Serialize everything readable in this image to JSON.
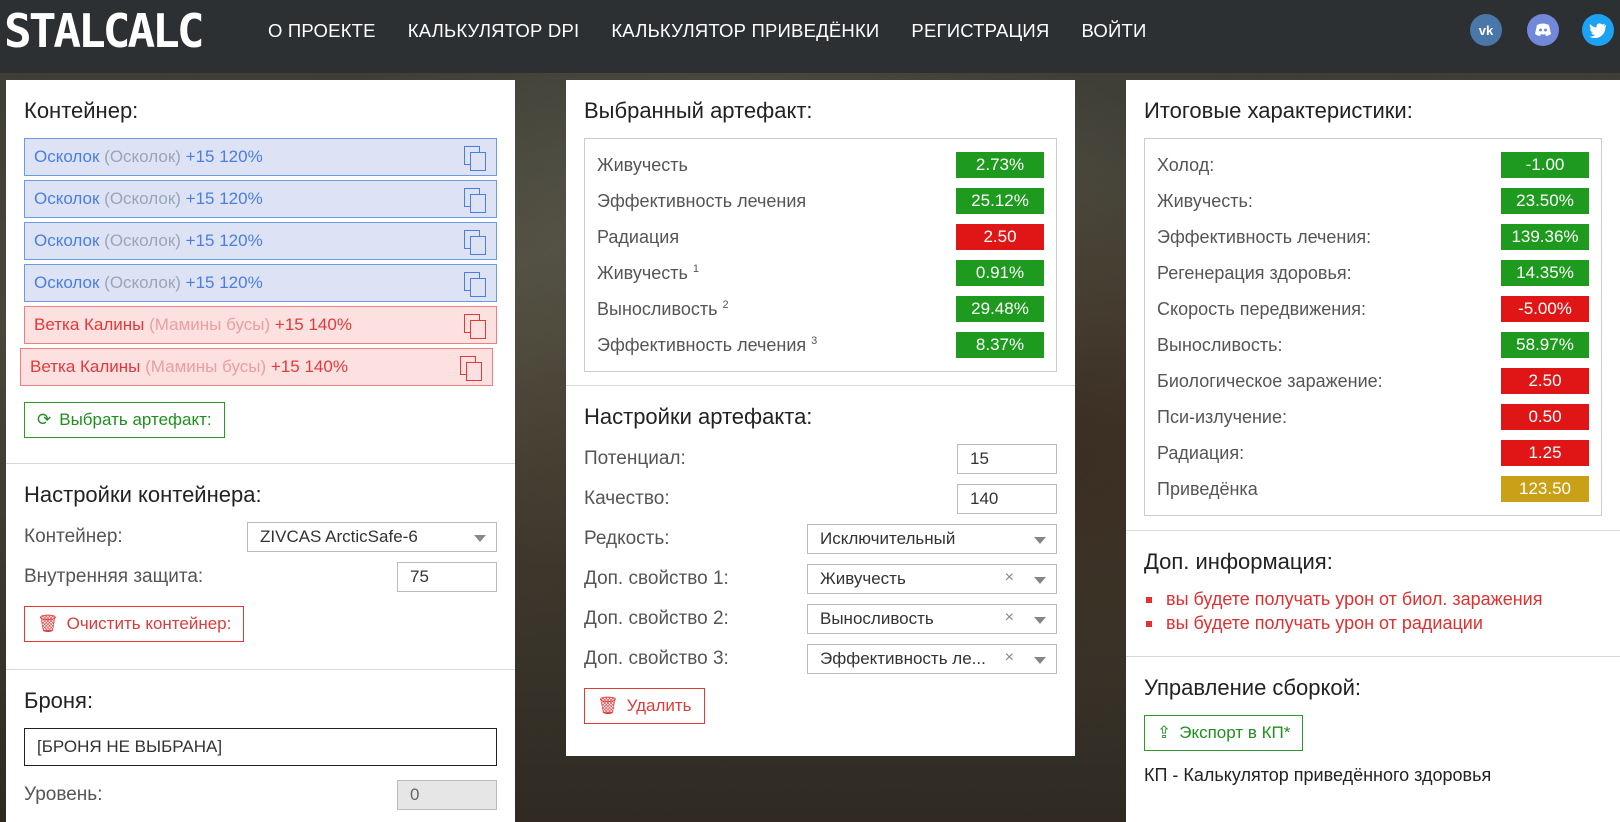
{
  "logo": "STALCALC",
  "nav": [
    "О ПРОЕКТЕ",
    "КАЛЬКУЛЯТОР DPI",
    "КАЛЬКУЛЯТОР ПРИВЕДЁНКИ",
    "РЕГИСТРАЦИЯ",
    "ВОЙТИ"
  ],
  "social": {
    "vk": "vk-icon",
    "discord": "discord-icon",
    "twitter": "twitter-icon"
  },
  "container": {
    "title": "Контейнер:",
    "slots": [
      {
        "name": "Осколок",
        "sub": "(Осколок)",
        "suffix": "+15 120%",
        "color": "blue"
      },
      {
        "name": "Осколок",
        "sub": "(Осколок)",
        "suffix": "+15 120%",
        "color": "blue"
      },
      {
        "name": "Осколок",
        "sub": "(Осколок)",
        "suffix": "+15 120%",
        "color": "blue"
      },
      {
        "name": "Осколок",
        "sub": "(Осколок)",
        "suffix": "+15 120%",
        "color": "blue"
      },
      {
        "name": "Ветка Калины",
        "sub": "(Мамины бусы)",
        "suffix": "+15 140%",
        "color": "red"
      },
      {
        "name": "Ветка Калины",
        "sub": "(Мамины бусы)",
        "suffix": "+15 140%",
        "color": "red"
      }
    ],
    "select_button": "Выбрать артефакт:"
  },
  "container_settings": {
    "title": "Настройки контейнера:",
    "container_label": "Контейнер:",
    "container_value": "ZIVCAS ArcticSafe-6",
    "protection_label": "Внутренняя защита:",
    "protection_value": "75",
    "clear_button": "Очистить контейнер:"
  },
  "armor": {
    "title": "Броня:",
    "value": "[БРОНЯ НЕ ВЫБРАНА]",
    "level_label": "Уровень:",
    "level_value": "0"
  },
  "selected_artifact": {
    "title": "Выбранный артефакт:",
    "stats": [
      {
        "label": "Живучесть",
        "sup": "",
        "value": "2.73%",
        "color": "g"
      },
      {
        "label": "Эффективность лечения",
        "sup": "",
        "value": "25.12%",
        "color": "g"
      },
      {
        "label": "Радиация",
        "sup": "",
        "value": "2.50",
        "color": "r"
      },
      {
        "label": "Живучесть",
        "sup": "1",
        "value": "0.91%",
        "color": "g"
      },
      {
        "label": "Выносливость",
        "sup": "2",
        "value": "29.48%",
        "color": "g"
      },
      {
        "label": "Эффективность лечения",
        "sup": "3",
        "value": "8.37%",
        "color": "g"
      }
    ]
  },
  "artifact_settings": {
    "title": "Настройки артефакта:",
    "potential_label": "Потенциал:",
    "potential_value": "15",
    "quality_label": "Качество:",
    "quality_value": "140",
    "rarity_label": "Редкость:",
    "rarity_value": "Исключительный",
    "prop1_label": "Доп. свойство 1:",
    "prop1_value": "Живучесть",
    "prop2_label": "Доп. свойство 2:",
    "prop2_value": "Выносливость",
    "prop3_label": "Доп. свойство 3:",
    "prop3_value": "Эффективность ле...",
    "delete_button": "Удалить"
  },
  "totals": {
    "title": "Итоговые характеристики:",
    "stats": [
      {
        "label": "Холод:",
        "value": "-1.00",
        "color": "g"
      },
      {
        "label": "Живучесть:",
        "value": "23.50%",
        "color": "g"
      },
      {
        "label": "Эффективность лечения:",
        "value": "139.36%",
        "color": "g"
      },
      {
        "label": "Регенерация здоровья:",
        "value": "14.35%",
        "color": "g"
      },
      {
        "label": "Скорость передвижения:",
        "value": "-5.00%",
        "color": "r"
      },
      {
        "label": "Выносливость:",
        "value": "58.97%",
        "color": "g"
      },
      {
        "label": "Биологическое заражение:",
        "value": "2.50",
        "color": "r"
      },
      {
        "label": "Пси-излучение:",
        "value": "0.50",
        "color": "r"
      },
      {
        "label": "Радиация:",
        "value": "1.25",
        "color": "r"
      },
      {
        "label": "Приведёнка",
        "value": "123.50",
        "color": "y"
      }
    ]
  },
  "extra_info": {
    "title": "Доп. информация:",
    "warnings": [
      "вы будете получать урон от биол. заражения",
      "вы будете получать урон от радиации"
    ]
  },
  "build": {
    "title": "Управление сборкой:",
    "export_button": "Экспорт в КП*",
    "note": "КП - Калькулятор приведённого здоровья"
  }
}
